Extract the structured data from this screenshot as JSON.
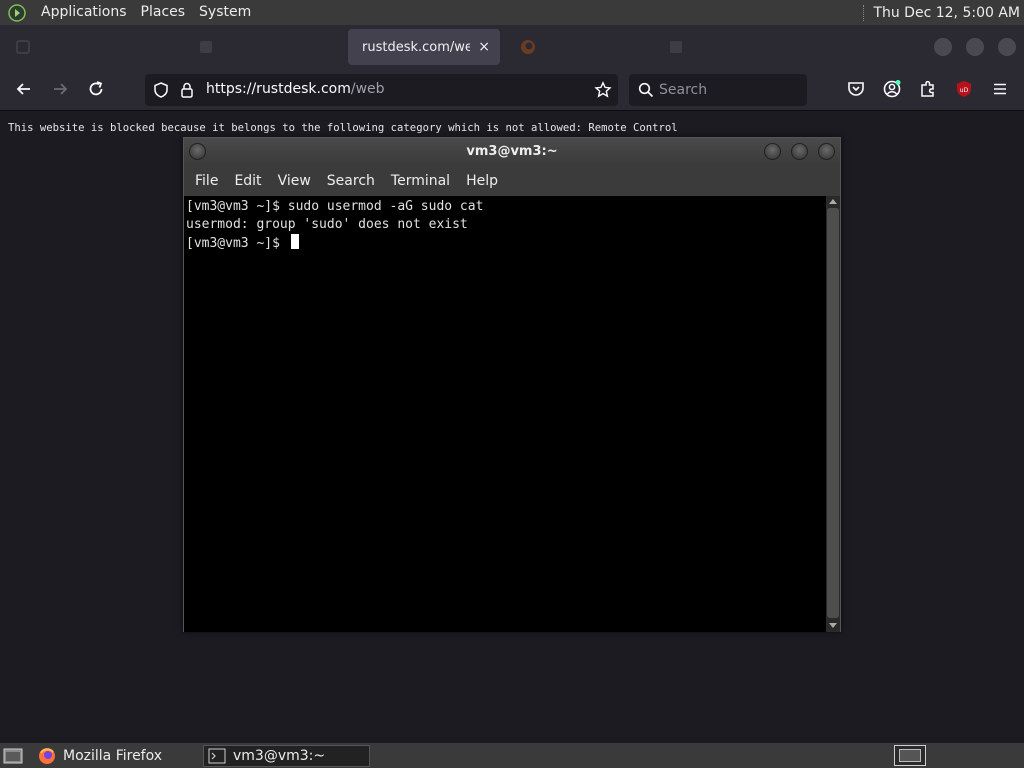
{
  "top_panel": {
    "menus": [
      "Applications",
      "Places",
      "System"
    ],
    "clock": "Thu Dec 12,  5:00 AM"
  },
  "browser": {
    "tabs": [
      {
        "label": "rustdesk.com/web",
        "active": true,
        "close": "×"
      }
    ],
    "address_bar": {
      "host": "https://rustdesk.com",
      "path": "/web"
    },
    "search_placeholder": "Search",
    "blocked_message": "This website is blocked because it belongs to the following category which is not allowed: Remote Control"
  },
  "terminal": {
    "title": "vm3@vm3:~",
    "menus": [
      "File",
      "Edit",
      "View",
      "Search",
      "Terminal",
      "Help"
    ],
    "lines": [
      "[vm3@vm3 ~]$ sudo usermod -aG sudo cat",
      "usermod: group 'sudo' does not exist",
      "[vm3@vm3 ~]$ "
    ]
  },
  "taskbar": {
    "items": [
      {
        "label": "Mozilla Firefox",
        "active": false
      },
      {
        "label": "vm3@vm3:~",
        "active": true
      }
    ]
  },
  "colors": {
    "panel_bg": "#3a3a3a",
    "browser_bg": "#1c1b22",
    "terminal_bg": "#000000",
    "ublock_red": "#b5121b"
  }
}
